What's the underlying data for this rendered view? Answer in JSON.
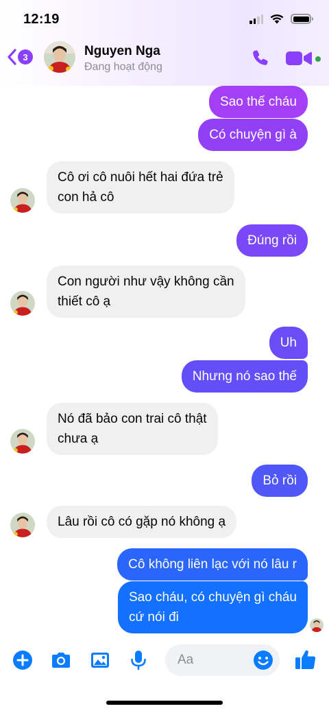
{
  "status_bar": {
    "time": "12:19"
  },
  "header": {
    "back_badge": "3",
    "contact_name": "Nguyen Nga",
    "presence": "Đang hoạt động"
  },
  "messages": [
    {
      "side": "out",
      "text": "Sao thế cháu"
    },
    {
      "side": "out",
      "text": "Có chuyện gì à"
    },
    {
      "side": "in",
      "text": "Cô ơi cô nuôi hết hai đứa trẻ\ncon hả cô"
    },
    {
      "side": "out",
      "text": "Đúng rồi"
    },
    {
      "side": "in",
      "text": "Con người như vậy không cần\nthiết cô ạ"
    },
    {
      "side": "out",
      "text": "Uh"
    },
    {
      "side": "out",
      "text": "Nhưng nó sao thế"
    },
    {
      "side": "in",
      "text": "Nó đã bảo con trai cô thật\nchưa ạ"
    },
    {
      "side": "out",
      "text": "Bỏ rồi"
    },
    {
      "side": "in",
      "text": "Lâu rồi cô có gặp nó không ạ"
    },
    {
      "side": "out",
      "text": "Cô không liên lạc với nó lâu r"
    },
    {
      "side": "out",
      "text": "Sao cháu, có chuyện gì cháu\ncứ nói đi"
    }
  ],
  "composer": {
    "placeholder": "Aa"
  },
  "icons": {
    "back": "chevron-left-icon",
    "call": "phone-icon",
    "video": "video-camera-icon",
    "plus": "plus-circle-icon",
    "camera": "camera-icon",
    "gallery": "image-icon",
    "mic": "microphone-icon",
    "emoji": "smiley-icon",
    "like": "thumbs-up-icon"
  },
  "colors": {
    "accent_purple": "#8a3ffc",
    "accent_blue": "#0a7cff",
    "incoming_bubble": "#f0f0f0",
    "online": "#31a24c"
  }
}
